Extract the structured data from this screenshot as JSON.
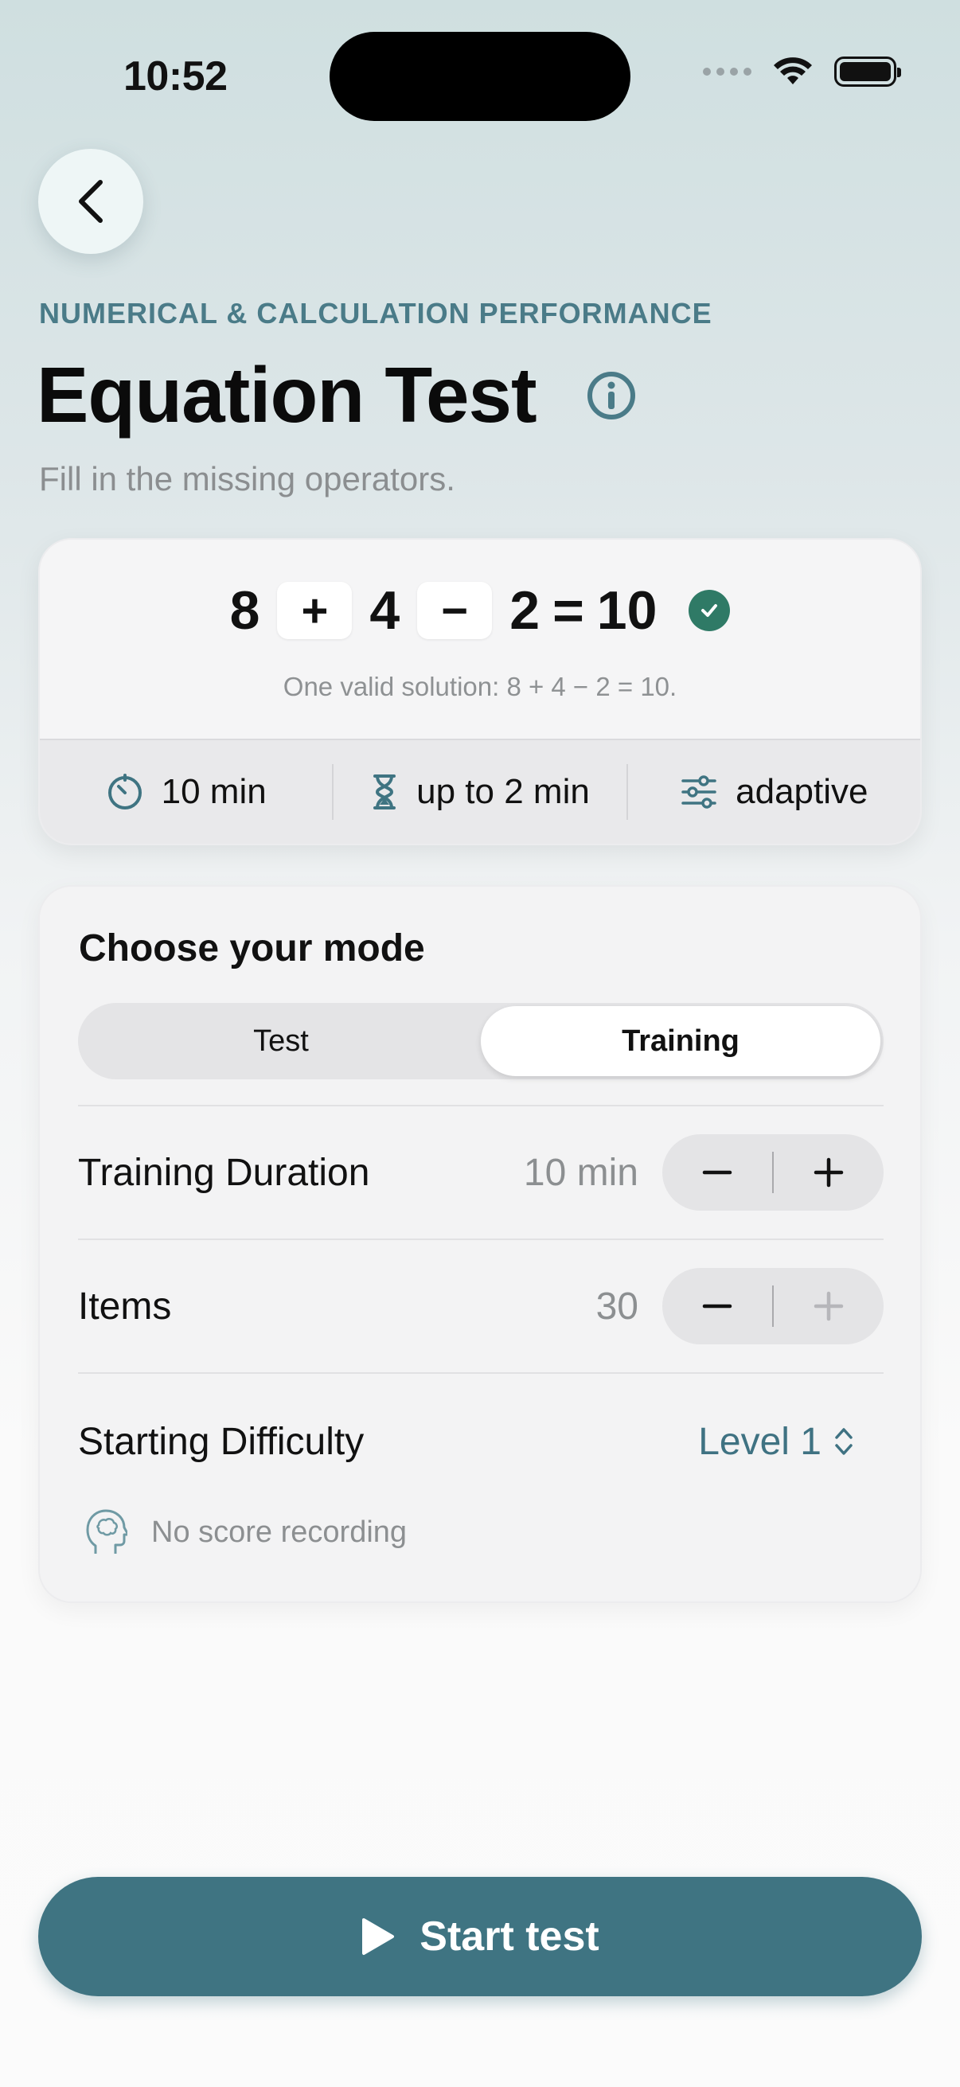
{
  "status_bar": {
    "time": "10:52"
  },
  "header": {
    "category": "NUMERICAL & CALCULATION PERFORMANCE",
    "title": "Equation Test",
    "subtitle": "Fill in the missing operators."
  },
  "example": {
    "tokens": [
      "8",
      "+",
      "4",
      "−",
      "2",
      "=",
      "10"
    ],
    "solution_text": "One valid solution: 8 + 4 − 2 = 10.",
    "meta": {
      "total_time": "10 min",
      "per_item": "up to 2 min",
      "difficulty_mode": "adaptive"
    }
  },
  "mode": {
    "title": "Choose your mode",
    "options": [
      "Test",
      "Training"
    ],
    "selected": "Training",
    "duration": {
      "label": "Training Duration",
      "value": "10 min"
    },
    "items": {
      "label": "Items",
      "value": "30"
    },
    "difficulty": {
      "label": "Starting Difficulty",
      "value": "Level 1"
    },
    "note": "No score recording"
  },
  "cta": {
    "label": "Start test"
  },
  "colors": {
    "accent": "#3f7482",
    "accent_text": "#4a7b88",
    "success": "#2f7a66"
  },
  "icons": [
    "back-chevron-icon",
    "info-icon",
    "timer-icon",
    "hourglass-icon",
    "sliders-icon",
    "minus-icon",
    "plus-icon",
    "chevron-up-down-icon",
    "brain-head-icon",
    "play-icon",
    "wifi-icon",
    "battery-icon",
    "checkmark-icon"
  ]
}
